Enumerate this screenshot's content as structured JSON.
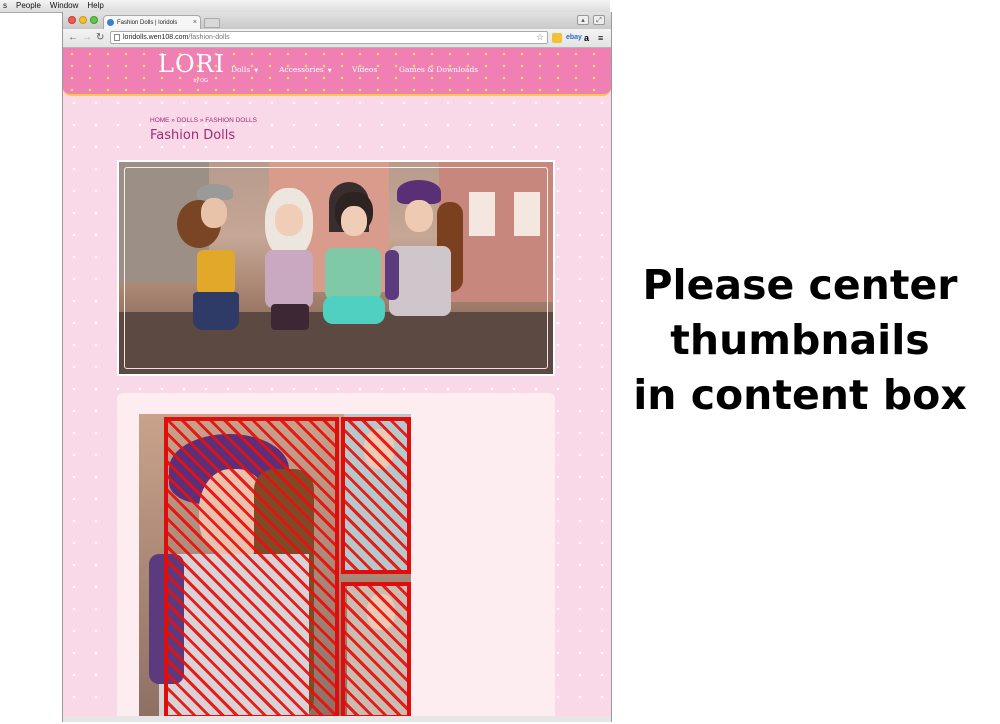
{
  "os_menu": [
    "s",
    "People",
    "Window",
    "Help"
  ],
  "browser": {
    "tab_title": "Fashion Dolls | loridols",
    "tab_close": "×",
    "url_host": "loridolls.wen108.com",
    "url_path": "/fashion-dolls",
    "nav": {
      "back": "←",
      "forward": "→",
      "reload": "↻"
    },
    "extensions": [
      "ebay",
      "a",
      "≡"
    ],
    "star_icon": "☆"
  },
  "site": {
    "logo": "LORI",
    "logo_sub": "by OG",
    "nav": [
      {
        "label": "Dolls",
        "caret": "▼"
      },
      {
        "label": "Accessories",
        "caret": "▼"
      },
      {
        "label": "Videos",
        "caret": ""
      },
      {
        "label": "Games & Downloads",
        "caret": ""
      }
    ],
    "breadcrumb": "HOME » DOLLS » FASHION DOLLS",
    "page_title": "Fashion Dolls"
  },
  "annotation": {
    "lines": [
      "Please center",
      "thumbnails",
      "in content box"
    ],
    "markup_color": "#e00d0d"
  },
  "colors": {
    "header_pink": "#f07fb3",
    "page_pink": "#f9d9e8",
    "title_purple": "#a0297a"
  }
}
